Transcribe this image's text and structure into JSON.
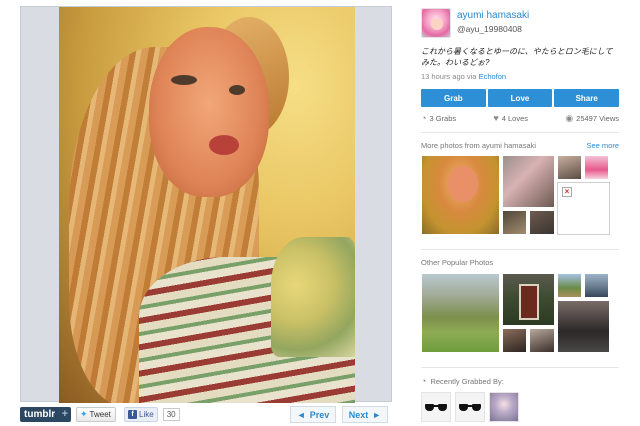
{
  "user": {
    "name": "ayumi hamasaki",
    "handle": "@ayu_19980408"
  },
  "post": {
    "caption": "これから暑くなるとゆーのに、やたらとロン毛にしてみた。わいるどぉ?",
    "time_ago": "13 hours ago via",
    "via": "Echofon"
  },
  "actions": {
    "grab": "Grab",
    "love": "Love",
    "share": "Share"
  },
  "stats": {
    "grabs": "3 Grabs",
    "loves": "4 Loves",
    "views": "25497 Views"
  },
  "more_photos": {
    "heading": "More photos from ayumi hamasaki",
    "see_more": "See more"
  },
  "popular": {
    "heading": "Other Popular Photos"
  },
  "recently": {
    "heading": "Recently Grabbed By:"
  },
  "share_bar": {
    "tumblr": "tumblr",
    "tumblr_plus": "+",
    "tweet": "Tweet",
    "like": "Like",
    "like_count": "30"
  },
  "pager": {
    "prev": "Prev",
    "next": "Next"
  },
  "icons": {
    "grabs": "grab-icon",
    "loves": "heart-icon",
    "views": "eye-icon",
    "recent": "grab-icon"
  },
  "colors": {
    "accent": "#2d8fd5",
    "link": "#2a8ad0"
  }
}
